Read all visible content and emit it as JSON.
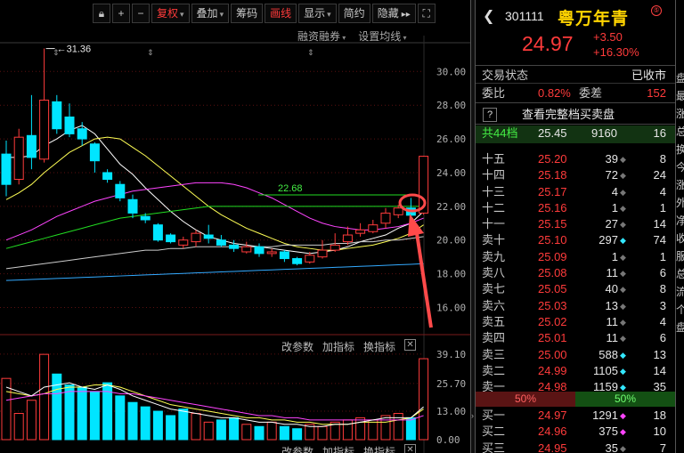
{
  "toolbar": {
    "restore_label": "复权",
    "overlay_label": "叠加",
    "chips_label": "筹码",
    "draw_label": "画线",
    "display_label": "显示",
    "simple_label": "简约",
    "hide_label": "隐藏"
  },
  "sub_toolbar": {
    "margin_label": "融资融券",
    "ma_label": "设置均线"
  },
  "indicator_bar": {
    "params_label": "改参数",
    "add_label": "加指标",
    "switch_label": "换指标"
  },
  "stock": {
    "code": "301111",
    "name": "粤万年青",
    "badge": "⑤",
    "price": "24.97",
    "change": "+3.50",
    "change_pct": "+16.30%"
  },
  "status": {
    "label": "交易状态",
    "value": "已收市"
  },
  "webi": {
    "label": "委比",
    "value": "0.82%",
    "diff_label": "委差",
    "diff_value": "152"
  },
  "full_book": {
    "q": "?",
    "label": "查看完整档买卖盘"
  },
  "total": {
    "label": "共44档",
    "price": "25.45",
    "vol": "9160",
    "num": "16"
  },
  "asks": [
    {
      "label": "十五",
      "price": "25.20",
      "vol": "39",
      "mk": "◆",
      "mkc": "gray",
      "num": "8"
    },
    {
      "label": "十四",
      "price": "25.18",
      "vol": "72",
      "mk": "◆",
      "mkc": "gray",
      "num": "24"
    },
    {
      "label": "十三",
      "price": "25.17",
      "vol": "4",
      "mk": "◆",
      "mkc": "gray",
      "num": "4"
    },
    {
      "label": "十二",
      "price": "25.16",
      "vol": "1",
      "mk": "◆",
      "mkc": "gray",
      "num": "1"
    },
    {
      "label": "十一",
      "price": "25.15",
      "vol": "27",
      "mk": "◆",
      "mkc": "gray",
      "num": "14"
    },
    {
      "label": "卖十",
      "price": "25.10",
      "vol": "297",
      "mk": "◆",
      "mkc": "cyan",
      "num": "74"
    },
    {
      "label": "卖九",
      "price": "25.09",
      "vol": "1",
      "mk": "◆",
      "mkc": "gray",
      "num": "1"
    },
    {
      "label": "卖八",
      "price": "25.08",
      "vol": "11",
      "mk": "◆",
      "mkc": "gray",
      "num": "6"
    },
    {
      "label": "卖七",
      "price": "25.05",
      "vol": "40",
      "mk": "◆",
      "mkc": "gray",
      "num": "8"
    },
    {
      "label": "卖六",
      "price": "25.03",
      "vol": "13",
      "mk": "◆",
      "mkc": "gray",
      "num": "3"
    },
    {
      "label": "卖五",
      "price": "25.02",
      "vol": "11",
      "mk": "◆",
      "mkc": "gray",
      "num": "4"
    },
    {
      "label": "卖四",
      "price": "25.01",
      "vol": "11",
      "mk": "◆",
      "mkc": "gray",
      "num": "6"
    },
    {
      "label": "卖三",
      "price": "25.00",
      "vol": "588",
      "mk": "◆",
      "mkc": "cyan",
      "num": "13"
    },
    {
      "label": "卖二",
      "price": "24.99",
      "vol": "1105",
      "mk": "◆",
      "mkc": "cyan",
      "num": "14"
    },
    {
      "label": "卖一",
      "price": "24.98",
      "vol": "1159",
      "mk": "◆",
      "mkc": "cyan",
      "num": "35"
    }
  ],
  "ratio": {
    "left": "50%",
    "right": "50%"
  },
  "bids": [
    {
      "label": "买一",
      "price": "24.97",
      "vol": "1291",
      "mk": "◆",
      "mkc": "mag",
      "num": "18"
    },
    {
      "label": "买二",
      "price": "24.96",
      "vol": "375",
      "mk": "◆",
      "mkc": "mag",
      "num": "10"
    },
    {
      "label": "买三",
      "price": "24.95",
      "vol": "35",
      "mk": "◆",
      "mkc": "gray",
      "num": "7"
    }
  ],
  "edge_labels": [
    "盘",
    "最",
    "涨",
    "总",
    "换",
    "今",
    "涨",
    "外",
    "净",
    "收",
    "服",
    "总",
    "流",
    "个",
    "盘"
  ],
  "colors": {
    "up": "#ff3b3b",
    "down": "#00e5ff",
    "name": "#ffd400",
    "ma5": "#ffffff",
    "ma10": "#ffff55",
    "ma20": "#ff44ff",
    "ma60": "#22dd22"
  },
  "chart_data": [
    {
      "type": "candlestick",
      "y_ticks": [
        "30.00",
        "28.00",
        "26.00",
        "24.00",
        "22.00",
        "20.00",
        "18.00",
        "16.00"
      ],
      "ylim": [
        14.6,
        31.6
      ],
      "grid": true,
      "annotations": [
        {
          "text": "←31.36",
          "index": 3,
          "value": 31.36
        },
        {
          "text": "22.68",
          "value": 22.68
        }
      ],
      "candles": [
        {
          "o": 25.1,
          "h": 25.9,
          "l": 22.6,
          "c": 23.3
        },
        {
          "o": 23.6,
          "h": 26.6,
          "l": 23.3,
          "c": 26.1
        },
        {
          "o": 26.2,
          "h": 28.6,
          "l": 24.2,
          "c": 24.9
        },
        {
          "o": 24.8,
          "h": 31.36,
          "l": 24.6,
          "c": 28.3
        },
        {
          "o": 28.2,
          "h": 28.6,
          "l": 26.3,
          "c": 26.6
        },
        {
          "o": 27.3,
          "h": 28.1,
          "l": 26.1,
          "c": 26.3
        },
        {
          "o": 26.6,
          "h": 27.0,
          "l": 25.6,
          "c": 26.0
        },
        {
          "o": 25.7,
          "h": 25.8,
          "l": 24.0,
          "c": 24.7
        },
        {
          "o": 24.0,
          "h": 24.2,
          "l": 23.4,
          "c": 23.6
        },
        {
          "o": 23.3,
          "h": 23.5,
          "l": 22.3,
          "c": 22.5
        },
        {
          "o": 22.4,
          "h": 22.7,
          "l": 21.3,
          "c": 21.6
        },
        {
          "o": 21.4,
          "h": 21.6,
          "l": 21.0,
          "c": 21.2
        },
        {
          "o": 20.9,
          "h": 21.0,
          "l": 19.9,
          "c": 20.0
        },
        {
          "o": 20.3,
          "h": 20.4,
          "l": 19.8,
          "c": 19.9
        },
        {
          "o": 19.7,
          "h": 20.2,
          "l": 19.5,
          "c": 20.0
        },
        {
          "o": 19.9,
          "h": 20.6,
          "l": 19.6,
          "c": 20.4
        },
        {
          "o": 20.3,
          "h": 20.9,
          "l": 19.8,
          "c": 20.1
        },
        {
          "o": 20.0,
          "h": 20.3,
          "l": 19.6,
          "c": 19.7
        },
        {
          "o": 19.7,
          "h": 20.0,
          "l": 19.3,
          "c": 19.5
        },
        {
          "o": 19.3,
          "h": 19.9,
          "l": 19.2,
          "c": 19.6
        },
        {
          "o": 19.6,
          "h": 19.8,
          "l": 19.0,
          "c": 19.2
        },
        {
          "o": 19.2,
          "h": 19.5,
          "l": 19.0,
          "c": 19.3
        },
        {
          "o": 19.3,
          "h": 19.4,
          "l": 18.7,
          "c": 18.9
        },
        {
          "o": 18.9,
          "h": 19.0,
          "l": 18.5,
          "c": 18.6
        },
        {
          "o": 18.7,
          "h": 19.3,
          "l": 18.6,
          "c": 19.1
        },
        {
          "o": 19.0,
          "h": 20.0,
          "l": 18.9,
          "c": 19.4
        },
        {
          "o": 19.4,
          "h": 20.4,
          "l": 19.3,
          "c": 19.7
        },
        {
          "o": 19.9,
          "h": 20.8,
          "l": 19.7,
          "c": 20.3
        },
        {
          "o": 20.4,
          "h": 21.0,
          "l": 20.2,
          "c": 20.6
        },
        {
          "o": 20.5,
          "h": 21.2,
          "l": 20.4,
          "c": 20.9
        },
        {
          "o": 21.0,
          "h": 21.9,
          "l": 20.7,
          "c": 21.6
        },
        {
          "o": 21.5,
          "h": 22.1,
          "l": 21.3,
          "c": 21.9
        },
        {
          "o": 21.9,
          "h": 22.5,
          "l": 21.3,
          "c": 21.47
        },
        {
          "o": 21.6,
          "h": 25.0,
          "l": 21.5,
          "c": 24.97
        }
      ],
      "ma": [
        {
          "color": "#ffffff",
          "values": [
            24.9,
            24.9,
            25.0,
            25.6,
            26.0,
            26.5,
            26.8,
            26.3,
            25.4,
            24.5,
            23.9,
            23.1,
            22.4,
            21.7,
            21.1,
            20.6,
            20.2,
            20.0,
            19.8,
            19.7,
            19.6,
            19.5,
            19.4,
            19.3,
            19.2,
            19.3,
            19.4,
            19.6,
            19.9,
            20.1,
            20.3,
            20.7,
            21.0,
            21.7
          ]
        },
        {
          "color": "#ffff55",
          "values": [
            22.4,
            22.8,
            23.3,
            24.0,
            24.6,
            25.2,
            25.6,
            26.0,
            26.1,
            26.0,
            25.5,
            25.0,
            24.4,
            23.8,
            23.2,
            22.6,
            22.0,
            21.5,
            21.1,
            20.7,
            20.4,
            20.1,
            19.8,
            19.6,
            19.5,
            19.4,
            19.4,
            19.5,
            19.6,
            19.7,
            19.9,
            20.1,
            20.4,
            20.9
          ]
        },
        {
          "color": "#ff44ff",
          "values": [
            20.0,
            20.3,
            20.6,
            21.0,
            21.4,
            21.7,
            22.0,
            22.3,
            22.5,
            22.7,
            22.9,
            23.0,
            23.1,
            23.2,
            23.3,
            23.4,
            23.4,
            23.4,
            23.3,
            23.1,
            22.8,
            22.5,
            22.1,
            21.7,
            21.3,
            21.0,
            20.8,
            20.7,
            20.6,
            20.6,
            20.7,
            20.8,
            21.0,
            21.3
          ]
        },
        {
          "color": "#22dd22",
          "values": [
            19.5,
            19.7,
            19.9,
            20.1,
            20.3,
            20.5,
            20.7,
            20.9,
            21.1,
            21.3,
            21.4,
            21.5,
            21.6,
            21.7,
            21.8,
            21.9,
            22.0,
            22.0,
            22.0,
            22.0,
            22.0,
            22.0,
            22.0,
            22.0,
            22.0,
            22.0,
            22.0,
            22.0,
            22.0,
            22.0,
            22.0,
            22.0,
            22.0,
            22.0
          ]
        },
        {
          "color": "#cccccc",
          "values": [
            18.3,
            18.4,
            18.5,
            18.6,
            18.7,
            18.8,
            18.9,
            19.0,
            19.1,
            19.2,
            19.3,
            19.4,
            19.4,
            19.5,
            19.5,
            19.6,
            19.6,
            19.6,
            19.6,
            19.6,
            19.6,
            19.6,
            19.7,
            19.7,
            19.7,
            19.7,
            19.8,
            19.8,
            19.9,
            19.9,
            20.0,
            20.0,
            20.1,
            20.2
          ]
        },
        {
          "color": "#33aaff",
          "values": [
            17.6,
            17.63,
            17.66,
            17.69,
            17.72,
            17.75,
            17.78,
            17.81,
            17.84,
            17.87,
            17.9,
            17.93,
            17.96,
            17.99,
            18.02,
            18.05,
            18.08,
            18.11,
            18.14,
            18.17,
            18.2,
            18.23,
            18.26,
            18.29,
            18.32,
            18.35,
            18.38,
            18.41,
            18.44,
            18.47,
            18.5,
            18.53,
            18.56,
            18.6
          ]
        }
      ]
    },
    {
      "type": "bar",
      "y_ticks": [
        "39.10",
        "25.70",
        "13.00",
        "0.00"
      ],
      "ylim": [
        0,
        41.5
      ],
      "values": [
        28,
        12,
        18,
        39,
        30,
        25,
        24,
        22,
        26,
        20,
        17,
        15,
        13,
        11,
        14,
        12,
        8,
        9,
        10,
        7,
        6,
        8,
        6,
        5,
        7,
        6,
        8,
        9,
        10,
        9,
        11,
        12,
        10,
        37
      ],
      "up": [
        true,
        true,
        true,
        true,
        false,
        false,
        false,
        false,
        false,
        false,
        false,
        false,
        false,
        false,
        false,
        true,
        true,
        false,
        false,
        true,
        false,
        true,
        false,
        false,
        true,
        true,
        true,
        true,
        true,
        true,
        true,
        true,
        false,
        true
      ],
      "lines": [
        {
          "color": "#ffff55",
          "values": [
            22,
            21,
            20,
            21,
            23,
            24,
            24,
            25,
            25,
            24,
            22,
            20,
            18,
            16,
            15,
            14,
            13,
            12,
            11,
            10,
            10,
            9,
            9,
            8,
            8,
            7,
            7,
            7,
            8,
            8,
            8,
            9,
            10,
            14
          ]
        },
        {
          "color": "#ff44ff",
          "values": [
            18,
            19,
            20,
            21,
            21,
            22,
            22,
            22,
            22,
            21,
            21,
            20,
            19,
            18,
            17,
            16,
            15,
            14,
            13,
            12,
            11,
            11,
            10,
            10,
            9,
            9,
            9,
            9,
            9,
            9,
            9,
            9,
            9,
            11
          ]
        },
        {
          "color": "#ffffff",
          "values": [
            24,
            22,
            20,
            24,
            25,
            26,
            24,
            23,
            25,
            23,
            20,
            18,
            16,
            14,
            13,
            12,
            11,
            10,
            10,
            9,
            8,
            8,
            7,
            7,
            6,
            6,
            7,
            7,
            8,
            9,
            10,
            10,
            10,
            15
          ]
        }
      ]
    }
  ]
}
